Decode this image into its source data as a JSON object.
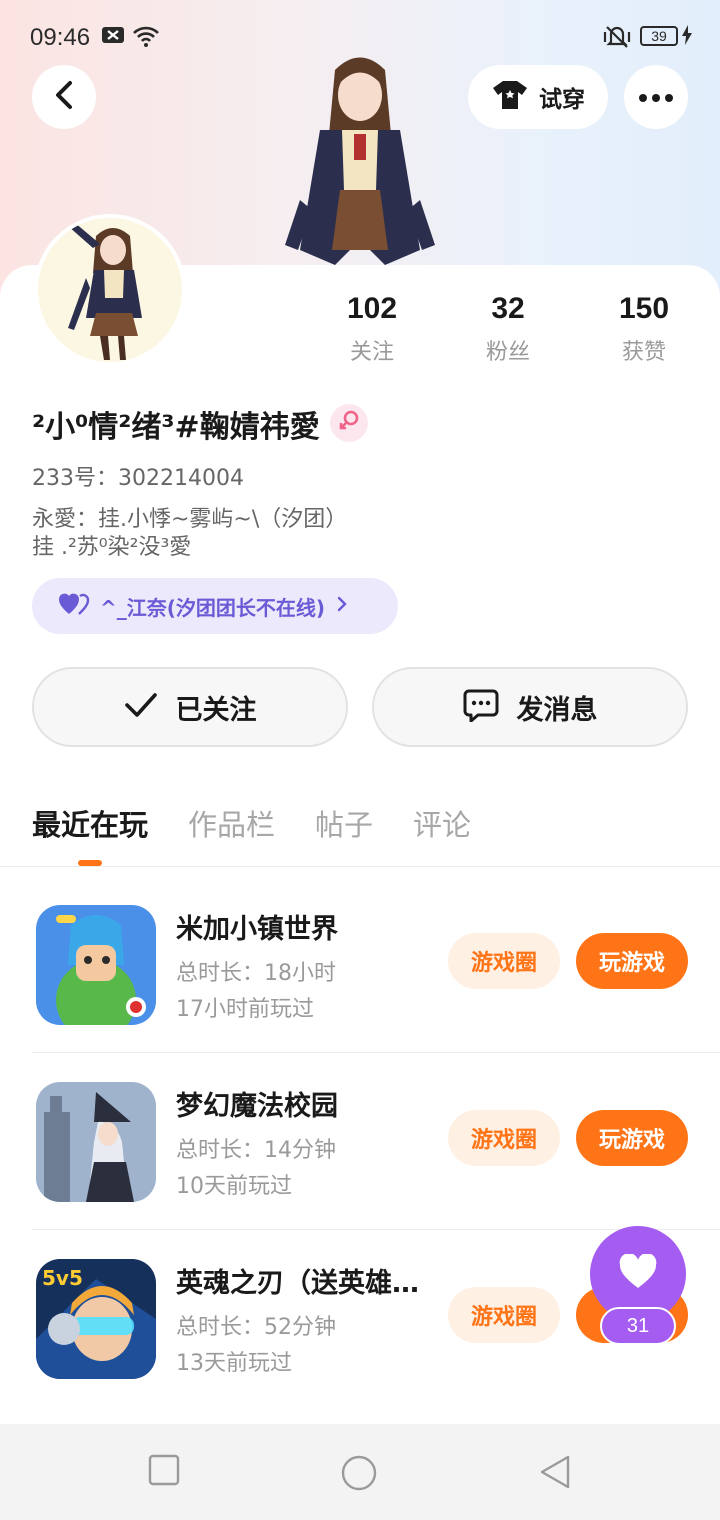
{
  "status_bar": {
    "time": "09:46",
    "battery": "39"
  },
  "header": {
    "try_on_label": "试穿"
  },
  "profile": {
    "nickname": "²小⁰情²绪³#鞠婧祎愛",
    "uid_label": "233号：302214004",
    "bio_line1": "永愛：挂.小悸~雾屿~\\（汐团）",
    "bio_line2": "挂 .²苏⁰染²没³愛",
    "club_label": "^_江奈(汐团团长不在线)",
    "stats": [
      {
        "value": "102",
        "label": "关注"
      },
      {
        "value": "32",
        "label": "粉丝"
      },
      {
        "value": "150",
        "label": "获赞"
      }
    ]
  },
  "actions": {
    "followed_label": "已关注",
    "message_label": "发消息"
  },
  "tabs": [
    {
      "label": "最近在玩",
      "active": true
    },
    {
      "label": "作品栏",
      "active": false
    },
    {
      "label": "帖子",
      "active": false
    },
    {
      "label": "评论",
      "active": false
    }
  ],
  "games": [
    {
      "title": "米加小镇世界",
      "duration": "总时长：18小时",
      "last_played": "17小时前玩过",
      "circle_label": "游戏圈",
      "play_label": "玩游戏"
    },
    {
      "title": "梦幻魔法校园",
      "duration": "总时长：14分钟",
      "last_played": "10天前玩过",
      "circle_label": "游戏圈",
      "play_label": "玩游戏"
    },
    {
      "title": "英魂之刃（送英雄…",
      "duration": "总时长：52分钟",
      "last_played": "13天前玩过",
      "circle_label": "游戏圈",
      "play_label": "玩"
    }
  ],
  "like_fab": {
    "count": "31"
  },
  "icons": {
    "back": "chevron-left-icon",
    "try_on": "tshirt-icon",
    "more": "more-dots-icon",
    "gender": "female-icon",
    "club": "heart-icon",
    "check": "check-icon",
    "message": "chat-bubble-icon",
    "like": "heart-icon"
  },
  "colors": {
    "accent": "#ff7417",
    "accent_light": "#fff0e4",
    "purple": "#a45df0",
    "club_text": "#6a5ad6",
    "club_bg": "#ebe9fb"
  }
}
